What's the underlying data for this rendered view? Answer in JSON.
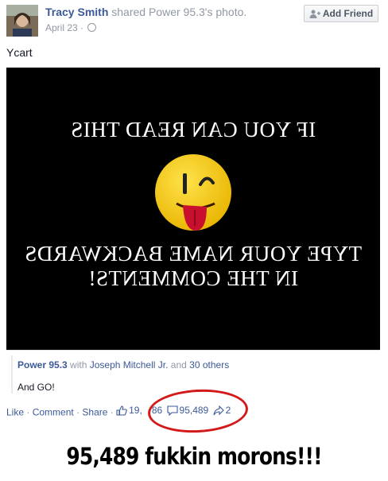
{
  "post": {
    "author": "Tracy Smith",
    "shared_text": "shared",
    "source_name": "Power 95.3's",
    "object": "photo.",
    "date": "April 23",
    "date_separator": "·",
    "message": "Ycart"
  },
  "add_friend": {
    "label": "Add Friend",
    "icon": "add-friend-icon"
  },
  "photo": {
    "line1": "IF YOU CAN READ THIS",
    "line2": "TYPE YOUR NAME BACKWARDS",
    "line3": "IN THE COMMENTS!",
    "mirrored": true
  },
  "share_source": {
    "page": "Power 95.3",
    "with": "with",
    "tagged": "Joseph Mitchell Jr.",
    "and": "and",
    "others": "30 others",
    "comment": "And GO!"
  },
  "actions": {
    "like": "Like",
    "comment": "Comment",
    "share": "Share",
    "separator": "·",
    "likes_count": "19,",
    "likes_count_tail": "86",
    "comments_count": "95,489",
    "shares_count": "2"
  },
  "caption": "95,489 fukkin morons!!!",
  "colors": {
    "link": "#3b5998",
    "annotation": "#d3191a",
    "photo_bg": "#000000"
  }
}
